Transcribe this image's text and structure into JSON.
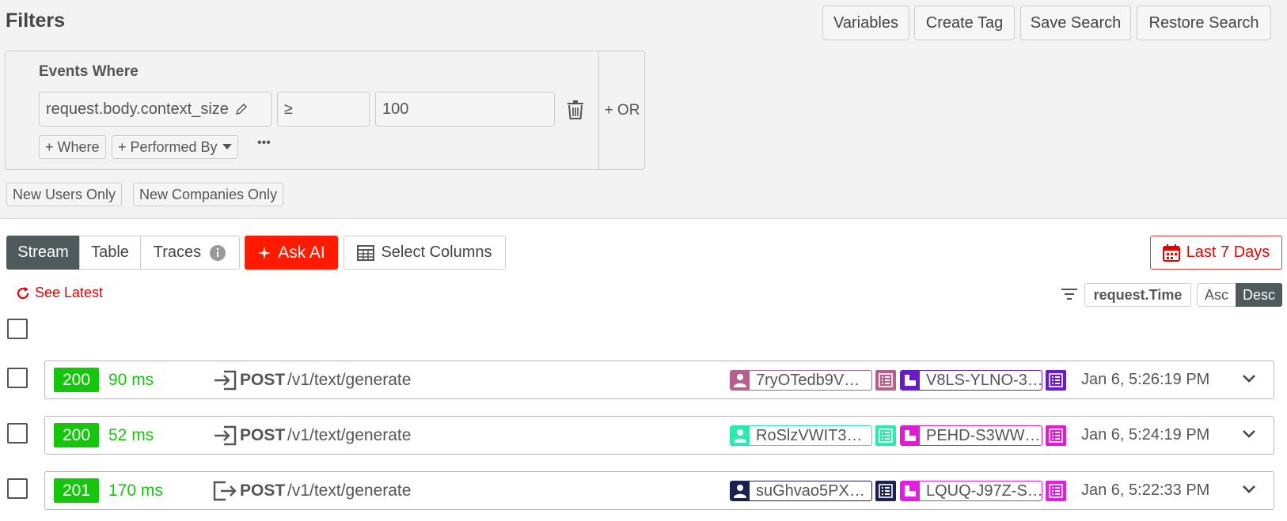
{
  "filters": {
    "title": "Filters",
    "buttons": [
      "Variables",
      "Create Tag",
      "Save Search",
      "Restore Search"
    ],
    "events_where": "Events Where",
    "field": "request.body.context_size",
    "operator": "≥",
    "value": "100",
    "add_where": "+ Where",
    "performed_by": "+ Performed By",
    "more": "•••",
    "or": "+ OR",
    "new_users": "New Users Only",
    "new_companies": "New Companies Only"
  },
  "toolbar": {
    "tabs": [
      "Stream",
      "Table",
      "Traces"
    ],
    "active_tab": "Stream",
    "ask_ai": "Ask AI",
    "select_columns": "Select Columns",
    "date_range": "Last 7 Days",
    "see_latest": "See Latest",
    "sort_field": "request.Time",
    "asc": "Asc",
    "desc": "Desc",
    "sort_order": "Desc"
  },
  "events": [
    {
      "status": "200",
      "duration": "90 ms",
      "direction": "incoming",
      "method": "POST",
      "path": "/v1/text/generate",
      "user_id": "7ryOTedb9V…",
      "user_color": "#b5608f",
      "company_id": "V8LS-YLNO-3…",
      "company_color": "#6a1bc9",
      "time": "Jan 6, 5:26:19 PM"
    },
    {
      "status": "200",
      "duration": "52 ms",
      "direction": "incoming",
      "method": "POST",
      "path": "/v1/text/generate",
      "user_id": "RoSlzVWIT3…",
      "user_color": "#2ee8b0",
      "company_id": "PEHD-S3WW…",
      "company_color": "#e31ad2",
      "time": "Jan 6, 5:24:19 PM"
    },
    {
      "status": "201",
      "duration": "170 ms",
      "direction": "outgoing",
      "method": "POST",
      "path": "/v1/text/generate",
      "user_id": "suGhvao5PX…",
      "user_color": "#1c2250",
      "company_id": "LQUQ-J97Z-S…",
      "company_color": "#e41ee0",
      "time": "Jan 6, 5:22:33 PM"
    }
  ],
  "colors": {
    "accent_red": "#e60000",
    "status_green": "#16c60c",
    "active_tab": "#4e5a5c"
  }
}
